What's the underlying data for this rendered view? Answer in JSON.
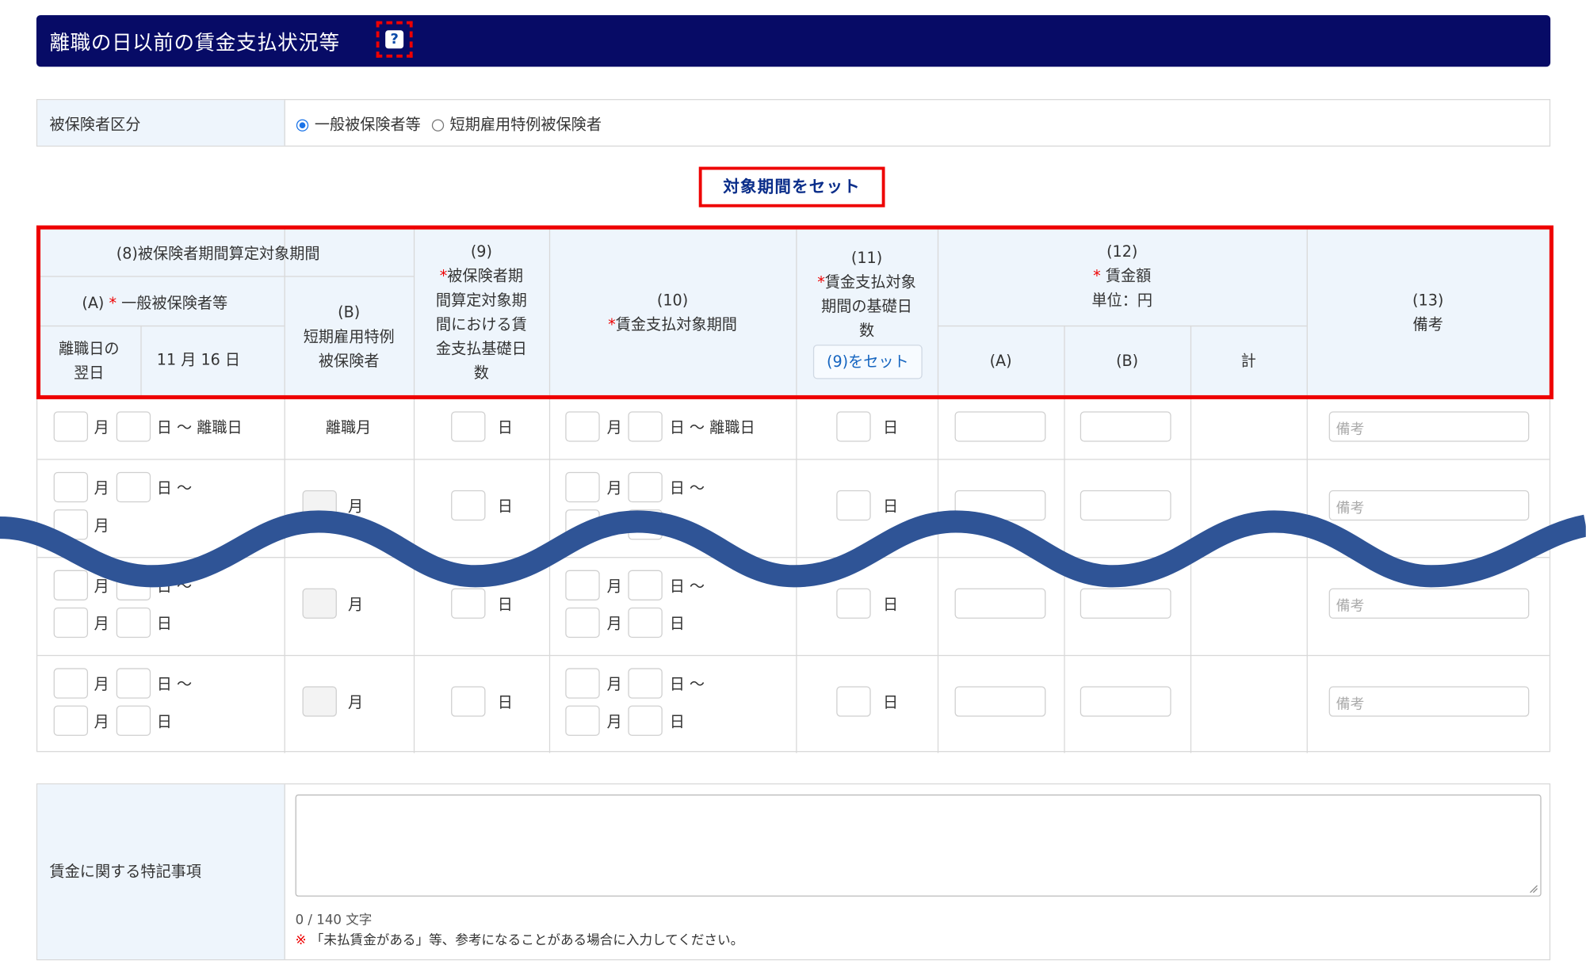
{
  "title": "離職の日以前の賃金支払状況等",
  "help_label": "?",
  "insured_category": {
    "label": "被保険者区分",
    "options": [
      "一般被保険者等",
      "短期雇用特例被保険者"
    ],
    "selected": "一般被保険者等"
  },
  "set_period_button": "対象期間をセット",
  "table_header": {
    "col8": "(8)被保険者期間算定対象期間",
    "col8a_num": "(A)",
    "col8a_req": "*",
    "col8a_text": "一般被保険者等",
    "col8a_next_day_1": "離職日の",
    "col8a_next_day_2": "翌日",
    "col8a_date": "11 月 16 日",
    "col8b_1": "(B)",
    "col8b_2": "短期雇用特例",
    "col8b_3": "被保険者",
    "col9_num": "(9)",
    "col9_req": "*",
    "col9_l1": "被保険者期",
    "col9_l2": "間算定対象期",
    "col9_l3": "間における賃",
    "col9_l4": "金支払基礎日",
    "col9_l5": "数",
    "col10_num": "(10)",
    "col10_req": "*",
    "col10_text": "賃金支払対象期間",
    "col11_num": "(11)",
    "col11_req": "*",
    "col11_l1": "賃金支払対象",
    "col11_l2": "期間の基礎日",
    "col11_l3": "数",
    "col11_button": "(9)をセット",
    "col12_num": "(12)",
    "col12_req": "*",
    "col12_text": "賃金額",
    "col12_unit": "単位：円",
    "col12_a": "(A)",
    "col12_b": "(B)",
    "col12_total": "計",
    "col13_num": "(13)",
    "col13_text": "備考"
  },
  "units": {
    "month": "月",
    "day": "日",
    "day_tilde": "日 ～",
    "day_tilde_rishoku": "日 ～ 離職日",
    "rishoku_month": "離職月"
  },
  "remarks_placeholder": "備考",
  "wage_notes": {
    "label": "賃金に関する特記事項",
    "counter": "0 / 140 文字",
    "note_mark": "※",
    "note_text": "「未払賃金がある」等、参考になることがある場合に入力してください。"
  },
  "colors": {
    "title_bg": "#070b66",
    "header_bg": "#eef5fc",
    "highlight": "#ee0000",
    "wave": "#2f5496"
  }
}
